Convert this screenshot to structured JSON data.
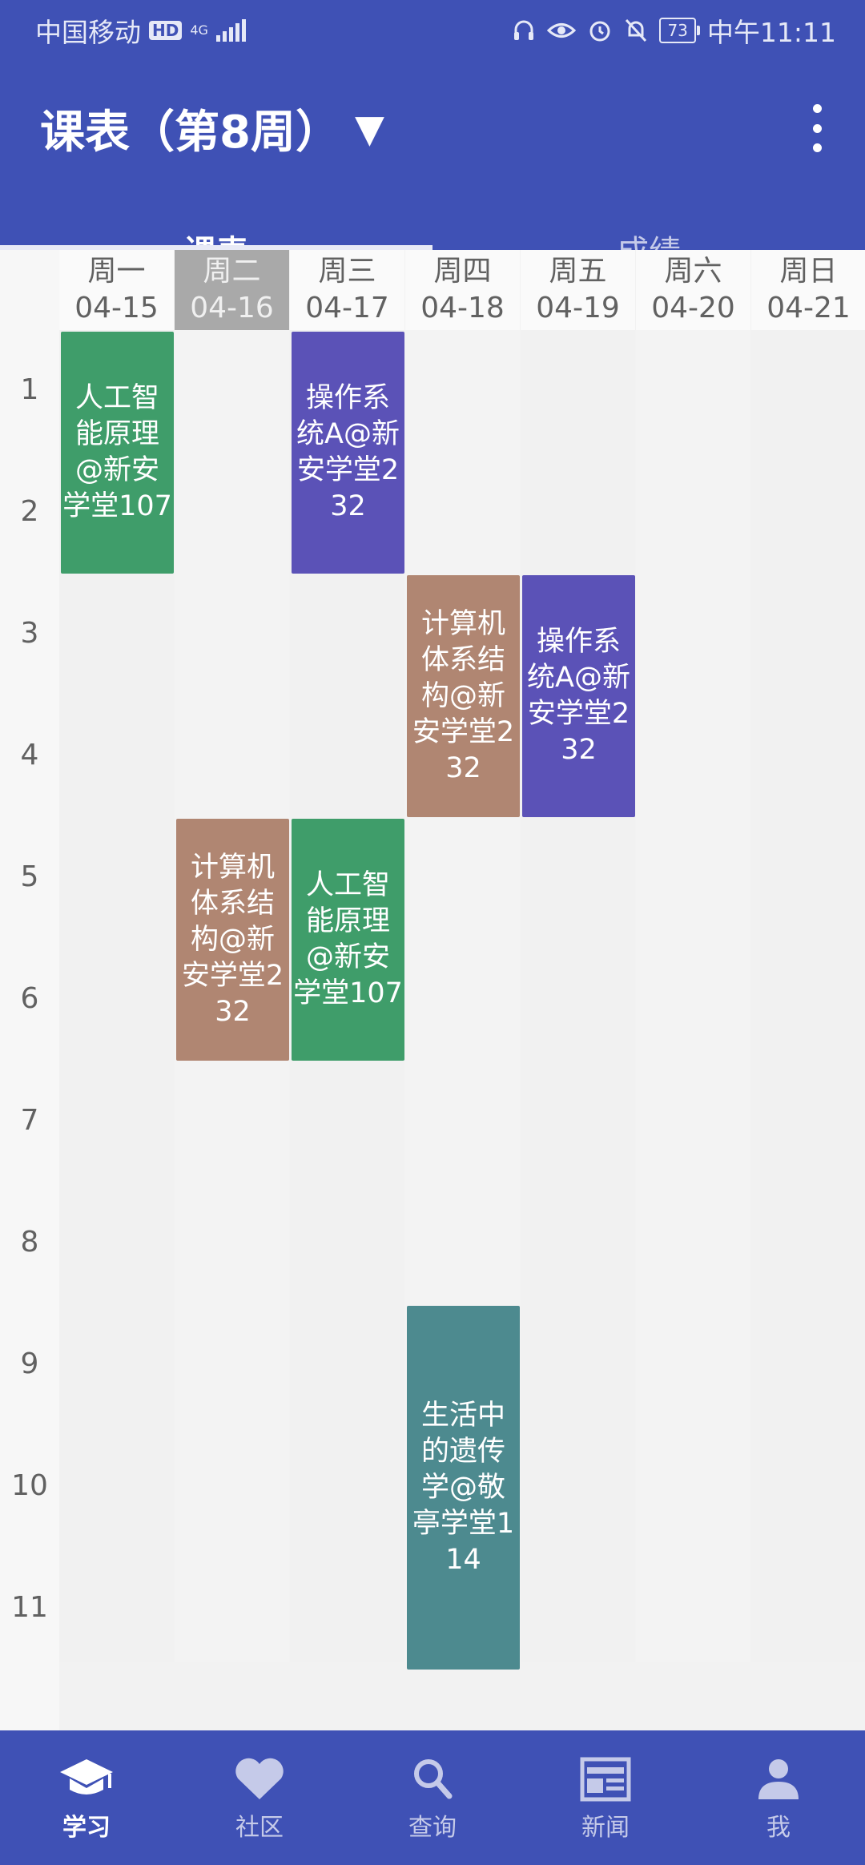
{
  "status": {
    "carrier": "中国移动",
    "hd": "HD",
    "network": "4G",
    "battery": "73",
    "time": "中午11:11"
  },
  "appbar": {
    "title": "课表（第8周）",
    "dropdown_glyph": "▼",
    "tabs": [
      {
        "label": "课表",
        "active": true
      },
      {
        "label": "成绩",
        "active": false
      }
    ]
  },
  "timetable": {
    "days": [
      {
        "name": "周一",
        "date": "04-15",
        "today": false
      },
      {
        "name": "周二",
        "date": "04-16",
        "today": true
      },
      {
        "name": "周三",
        "date": "04-17",
        "today": false
      },
      {
        "name": "周四",
        "date": "04-18",
        "today": false
      },
      {
        "name": "周五",
        "date": "04-19",
        "today": false
      },
      {
        "name": "周六",
        "date": "04-20",
        "today": false
      },
      {
        "name": "周日",
        "date": "04-21",
        "today": false
      }
    ],
    "periods": [
      "1",
      "2",
      "3",
      "4",
      "5",
      "6",
      "7",
      "8",
      "9",
      "10",
      "11"
    ],
    "courses": [
      {
        "text": "人工智能原理@新安学堂107",
        "day": 0,
        "start": 1,
        "end": 2,
        "color": "#3f9d6a"
      },
      {
        "text": "操作系统A@新安学堂232",
        "day": 2,
        "start": 1,
        "end": 2,
        "color": "#5b52b7"
      },
      {
        "text": "计算机体系结构@新安学堂232",
        "day": 3,
        "start": 3,
        "end": 4,
        "color": "#b08672"
      },
      {
        "text": "操作系统A@新安学堂232",
        "day": 4,
        "start": 3,
        "end": 4,
        "color": "#5b52b7"
      },
      {
        "text": "计算机体系结构@新安学堂232",
        "day": 1,
        "start": 5,
        "end": 6,
        "color": "#b08672"
      },
      {
        "text": "人工智能原理@新安学堂107",
        "day": 2,
        "start": 5,
        "end": 6,
        "color": "#3f9d6a"
      },
      {
        "text": "生活中的遗传学@敬亭学堂114",
        "day": 3,
        "start": 9,
        "end": 11,
        "color": "#4d8a8f"
      }
    ]
  },
  "bottom_nav": [
    {
      "label": "学习",
      "icon": "graduation-cap-icon",
      "active": true
    },
    {
      "label": "社区",
      "icon": "heart-icon",
      "active": false
    },
    {
      "label": "查询",
      "icon": "search-icon",
      "active": false
    },
    {
      "label": "新闻",
      "icon": "newspaper-icon",
      "active": false
    },
    {
      "label": "我",
      "icon": "person-icon",
      "active": false
    }
  ],
  "colors": {
    "primary": "#3f51b5",
    "today_header": "#a9a9a9"
  }
}
